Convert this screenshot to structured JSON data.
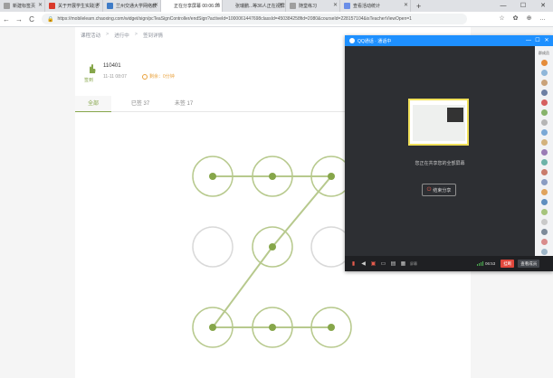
{
  "browser": {
    "tabs": [
      {
        "label": "新建标签页",
        "fav_color": "#9e9e9e",
        "width": 50,
        "active": false
      },
      {
        "label": "关于开展学生实践活",
        "fav_color": "#d9392b",
        "width": 64,
        "active": false
      },
      {
        "label": "兰州交通大学网络教",
        "fav_color": "#3e7bc7",
        "width": 64,
        "active": false
      },
      {
        "label": "正在分享屏幕  00:06:18",
        "fav_color": "",
        "width": 68,
        "active": true
      },
      {
        "label": "张瑞鹏...等36人正在视屏",
        "fav_color": "",
        "width": 70,
        "active": false
      },
      {
        "label": "随堂练习",
        "fav_color": "#9e9e9e",
        "width": 60,
        "active": false
      },
      {
        "label": "查看活动统计",
        "fav_color": "#6a8ee8",
        "width": 78,
        "active": false
      }
    ],
    "url": "https://mobilelearn.chaoxing.com/widget/sign/pcTeaSignController/endSign?activeId=1000061447698classId=450384258fid=2080&courseId=228157104&isTeacherViewOpen=1",
    "new_tab": "+",
    "win_controls": [
      "—",
      "☐",
      "✕"
    ],
    "nav_icons": [
      "←",
      "→",
      "C"
    ],
    "tool_icons": [
      "☆",
      "✿",
      "⊕",
      "…"
    ]
  },
  "page": {
    "breadcrumb": [
      "课程活动",
      "进行中",
      "签到详情"
    ],
    "activity": {
      "type_label": "签到",
      "title": "110401",
      "time": "11-11 08:07",
      "status": "剩余：0分钟"
    },
    "tabs": [
      "全部",
      "已签 37",
      "未签 17"
    ]
  },
  "pattern": {
    "node_color": "#86a64a",
    "ring_color": "#b7c98d",
    "inactive_ring": "#d9d9d9",
    "active_nodes": [
      true,
      true,
      true,
      false,
      true,
      false,
      true,
      true,
      true
    ],
    "path": [
      0,
      1,
      2,
      4,
      6,
      7,
      8
    ]
  },
  "qq_share": {
    "title": "QQ通话 · 通话中",
    "share_text": "您正在共享您的全部屏幕",
    "end_share_label": "结束分享",
    "side_title": "群成员",
    "duration": "06:53",
    "end_label": "挂断",
    "view_label": "查看成员",
    "foot_label": "屏幕",
    "avatar_colors": [
      "#e58c3a",
      "#8fb6d9",
      "#c9a27a",
      "#6d7fa3",
      "#d65f5f",
      "#87b36b",
      "#b5b5b5",
      "#7aa8d6",
      "#d3b27c",
      "#9a7bb5",
      "#6cb3a8",
      "#c97b6b",
      "#8a9cc2",
      "#e0a35c",
      "#5f8fbf",
      "#a6c47c",
      "#c9c9c9",
      "#7d8a99",
      "#d98c8c",
      "#9fb7c9",
      "#c2a680"
    ]
  }
}
